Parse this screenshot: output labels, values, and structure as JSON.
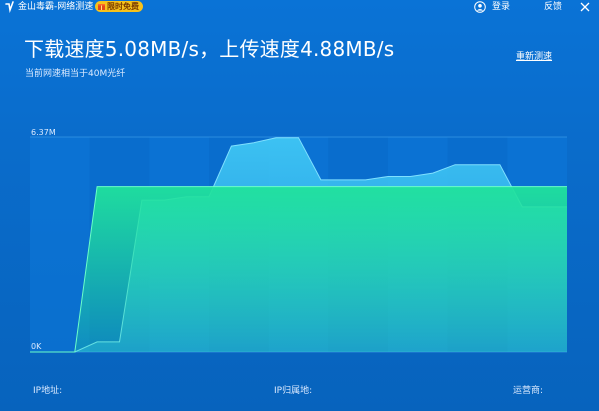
{
  "app": {
    "title": "金山毒霸-网络测速",
    "badge": "限时免费",
    "login": "登录",
    "feedback": "反馈"
  },
  "result": {
    "headline": "下载速度5.08MB/s，上传速度4.88MB/s",
    "note": "当前网速相当于40M光纤",
    "retest": "重新测速"
  },
  "chart_data": {
    "type": "area",
    "y_max_label": "6.37M",
    "y_min_label": "0K",
    "ylim": [
      0,
      6.37
    ],
    "series": [
      {
        "color": "#3fc6f4",
        "values": [
          0,
          0,
          0,
          0.3,
          0.3,
          4.5,
          4.5,
          4.6,
          4.6,
          6.1,
          6.2,
          6.35,
          6.35,
          5.1,
          5.1,
          5.1,
          5.2,
          5.2,
          5.3,
          5.55,
          5.55,
          5.55,
          4.3,
          4.3,
          4.3
        ]
      },
      {
        "color": "#20e29c",
        "values": [
          0,
          0,
          0,
          4.9,
          4.9,
          4.9,
          4.9,
          4.9,
          4.9,
          4.9,
          4.9,
          4.9,
          4.9,
          4.9,
          4.9,
          4.9,
          4.9,
          4.9,
          4.9,
          4.9,
          4.9,
          4.9,
          4.9,
          4.9,
          4.9
        ]
      }
    ]
  },
  "footer": {
    "ip": "IP地址:",
    "region": "IP归属地:",
    "isp": "运营商:"
  }
}
